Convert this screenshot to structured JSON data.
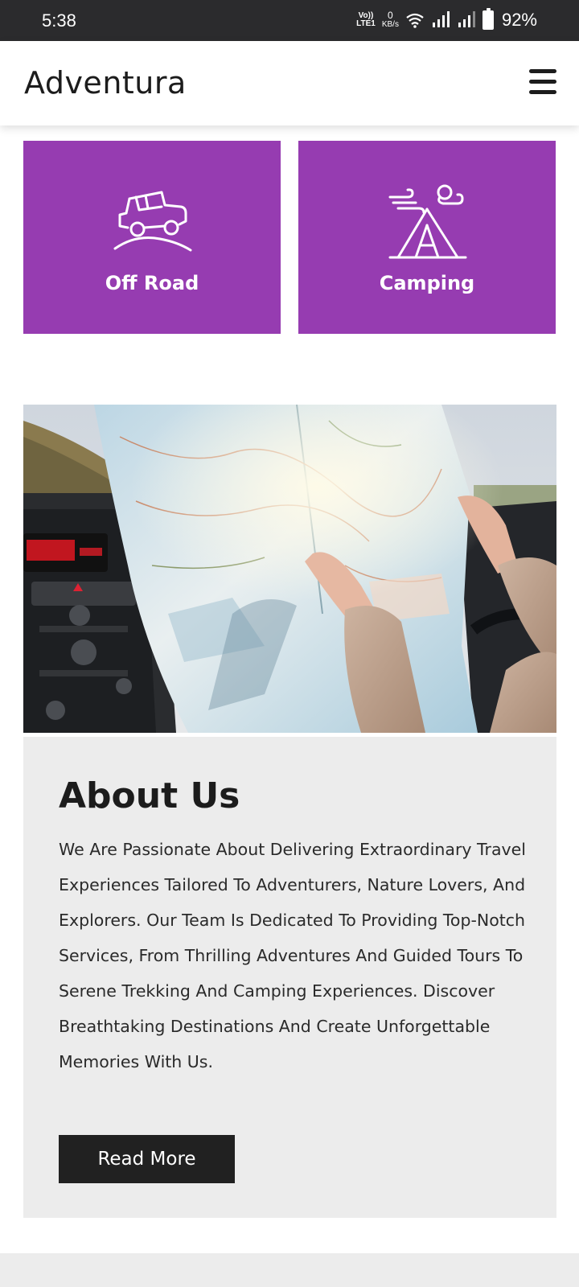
{
  "status_bar": {
    "time": "5:38",
    "volte_top": "Vo))",
    "volte_bottom": "LTE1",
    "net_value": "0",
    "net_unit": "KB/s",
    "battery": "92%"
  },
  "header": {
    "brand": "Adventura",
    "menu_icon": "hamburger-menu-icon"
  },
  "services": [
    {
      "label": "Off Road",
      "icon": "jeep-icon"
    },
    {
      "label": "Camping",
      "icon": "tent-icon"
    }
  ],
  "about": {
    "image": "map-in-car-photo",
    "title": "About Us",
    "text": "We Are Passionate About Delivering Extraordinary Travel Experiences Tailored To Adventurers, Nature Lovers, And Explorers. Our Team Is Dedicated To Providing Top-Notch Services, From Thrilling Adventures And Guided Tours To Serene Trekking And Camping Experiences. Discover Breathtaking Destinations And Create Unforgettable Memories With Us.",
    "button": "Read More"
  },
  "colors": {
    "accent": "#963cb1",
    "status_bar": "#2b2b2d",
    "button": "#212121",
    "panel": "#ececec"
  }
}
